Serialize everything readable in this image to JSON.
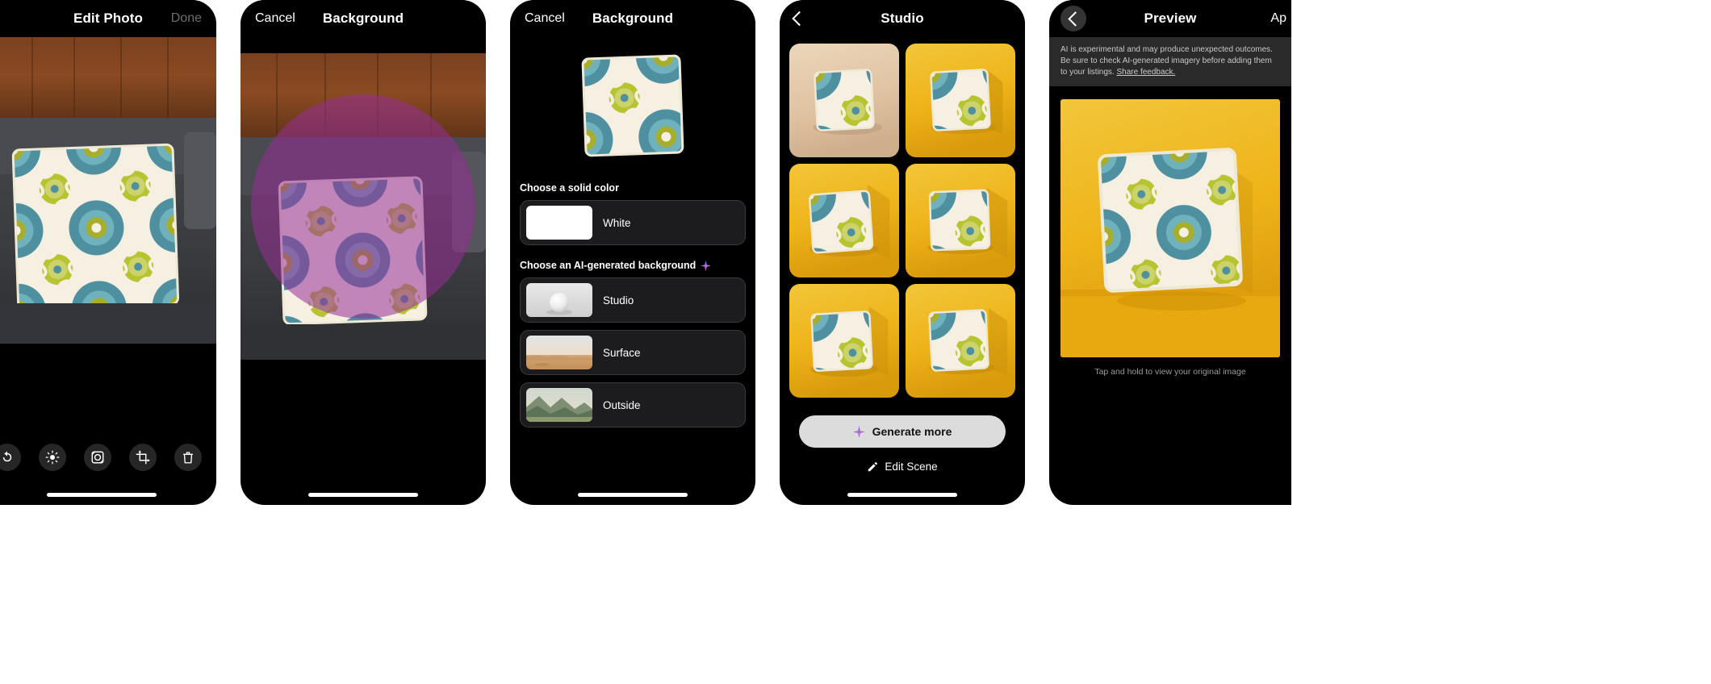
{
  "app": {
    "accent_purple": "#982E98",
    "accent_gold": "#E8B225",
    "pillow_teal": "#4A8D9E",
    "pillow_olive": "#A9B32A",
    "pillow_cream": "#F3EDDC"
  },
  "panels": [
    {
      "id": "edit-photo",
      "nav": {
        "title": "Edit Photo",
        "right_label": "Done",
        "right_disabled": true
      },
      "toolbar": [
        {
          "name": "rotate-icon",
          "label": "Rotate"
        },
        {
          "name": "brightness-icon",
          "label": "Adjust"
        },
        {
          "name": "background-icon",
          "label": "Background"
        },
        {
          "name": "crop-icon",
          "label": "Crop"
        },
        {
          "name": "trash-icon",
          "label": "Delete"
        }
      ]
    },
    {
      "id": "background-mask",
      "nav": {
        "title": "Background",
        "left_label": "Cancel"
      },
      "brush_color": "#982E98"
    },
    {
      "id": "background-options",
      "nav": {
        "title": "Background",
        "left_label": "Cancel"
      },
      "solid_section_label": "Choose a solid color",
      "solid_options": [
        {
          "label": "White",
          "swatch": "#FFFFFF"
        }
      ],
      "ai_section_label": "Choose an AI-generated background",
      "ai_options": [
        {
          "label": "Studio",
          "thumb": "sphere-studio"
        },
        {
          "label": "Surface",
          "thumb": "desert-surface"
        },
        {
          "label": "Outside",
          "thumb": "mountain-outside"
        }
      ]
    },
    {
      "id": "studio",
      "nav": {
        "title": "Studio",
        "back": true
      },
      "results": [
        {
          "bg": "#E3C8A8",
          "alt": "pillow on beige studio background"
        },
        {
          "bg": "#EFBB2A",
          "alt": "pillow on yellow studio background"
        },
        {
          "bg": "#EFB81F",
          "alt": "pillow on gold studio background"
        },
        {
          "bg": "#F0BC26",
          "alt": "pillow on gold studio background"
        },
        {
          "bg": "#EFB61C",
          "alt": "pillow on gold studio background"
        },
        {
          "bg": "#EFB920",
          "alt": "pillow on gold studio background"
        }
      ],
      "generate_more_label": "Generate more",
      "edit_scene_label": "Edit Scene"
    },
    {
      "id": "preview",
      "nav": {
        "title": "Preview",
        "right_label": "Ap",
        "back": true
      },
      "banner": {
        "text": "AI is experimental and may produce unexpected outcomes. Be sure to check AI-generated imagery before adding them to your listings.",
        "link_label": "Share feedback."
      },
      "caption": "Tap and hold to view your original image"
    }
  ]
}
